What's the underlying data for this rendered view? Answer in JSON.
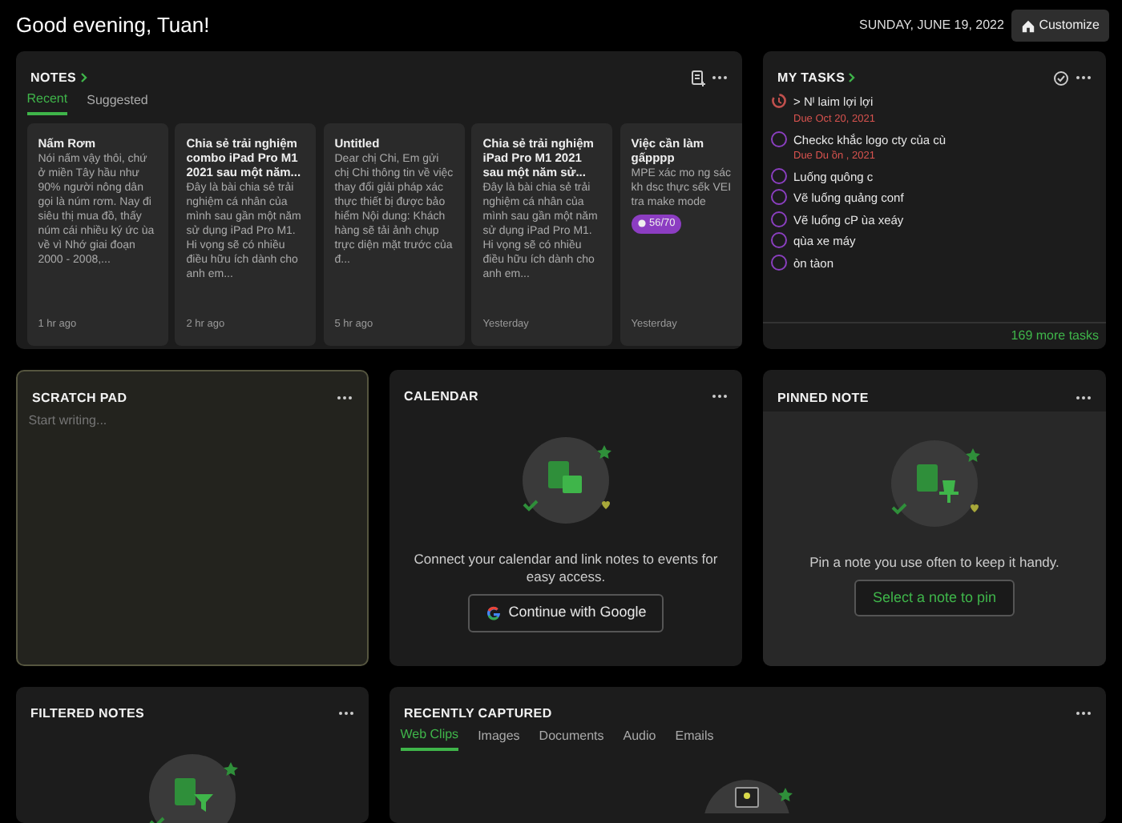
{
  "header": {
    "greeting": "Good evening, Tuan!",
    "date": "SUNDAY, JUNE 19, 2022",
    "customize": "Customize"
  },
  "notes": {
    "title": "NOTES",
    "tabs": [
      {
        "label": "Recent",
        "selected": true
      },
      {
        "label": "Suggested",
        "selected": false
      }
    ],
    "items": [
      {
        "title": "Nấm Rơm",
        "body": "Nói nấm vậy thôi, chứ ở miền Tây hầu như 90% người nông dân gọi là núm rơm. Nay đi siêu thị mua đồ, thấy núm cái nhiều ký ức ùa về vì Nhớ giai đoạn 2000 - 2008,...",
        "time": "1 hr ago"
      },
      {
        "title": "Chia sẻ trải nghiệm combo iPad Pro M1 2021 sau một năm...",
        "body": "Đây là bài chia sẻ trải nghiệm cá nhân của mình sau gần một năm sử dụng iPad Pro M1. Hi vọng sẽ có nhiều điều hữu ích dành cho anh em...",
        "time": "2 hr ago"
      },
      {
        "title": "Untitled",
        "body": "Dear chị Chi, Em gửi chị Chi thông tin về việc thay đổi giải pháp xác thực thiết bị được bảo hiểm Nội dung: Khách hàng sẽ tải ảnh chụp trực diện mặt trước của đ...",
        "time": "5 hr ago"
      },
      {
        "title": "Chia sẻ trải nghiệm iPad Pro M1 2021 sau một năm sử...",
        "body": "Đây là bài chia sẻ trải nghiệm cá nhân của mình sau gần một năm sử dụng iPad Pro M1. Hi vọng sẽ có nhiều điều hữu ích dành cho anh em...",
        "time": "Yesterday"
      },
      {
        "title": "Việc cần làm gấpppp",
        "body": "MPE xác mo ng sác kh dsc thực sếk VEI tra make mode",
        "badge": "56/70",
        "time": "Yesterday"
      }
    ]
  },
  "tasks": {
    "title": "MY TASKS",
    "items": [
      {
        "kind": "overdue",
        "text": "> Nᴵ laim lợi lợi",
        "due": "Due Oct 20, 2021"
      },
      {
        "kind": "open",
        "text": "Checkc khắc logo cty của cù",
        "due": "Due Du ồn , 2021"
      },
      {
        "kind": "open",
        "text": "Luống quông c"
      },
      {
        "kind": "open",
        "text": "Vẽ luống quảng conf"
      },
      {
        "kind": "open",
        "text": "Vẽ luống cP ùa xeáy"
      },
      {
        "kind": "open",
        "text": "qùa xe máy"
      },
      {
        "kind": "open",
        "text": "òn tàon"
      }
    ],
    "more": "169 more tasks"
  },
  "scratch": {
    "title": "SCRATCH PAD",
    "placeholder": "Start writing..."
  },
  "calendar": {
    "title": "CALENDAR",
    "message": "Connect your calendar and link notes to events for easy access.",
    "button": "Continue with Google"
  },
  "pinned": {
    "title": "PINNED NOTE",
    "message": "Pin a note you use often to keep it handy.",
    "button": "Select a note to pin"
  },
  "filtered": {
    "title": "FILTERED NOTES"
  },
  "captured": {
    "title": "RECENTLY CAPTURED",
    "tabs": [
      {
        "label": "Web Clips",
        "selected": true
      },
      {
        "label": "Images",
        "selected": false
      },
      {
        "label": "Documents",
        "selected": false
      },
      {
        "label": "Audio",
        "selected": false
      },
      {
        "label": "Emails",
        "selected": false
      }
    ]
  }
}
